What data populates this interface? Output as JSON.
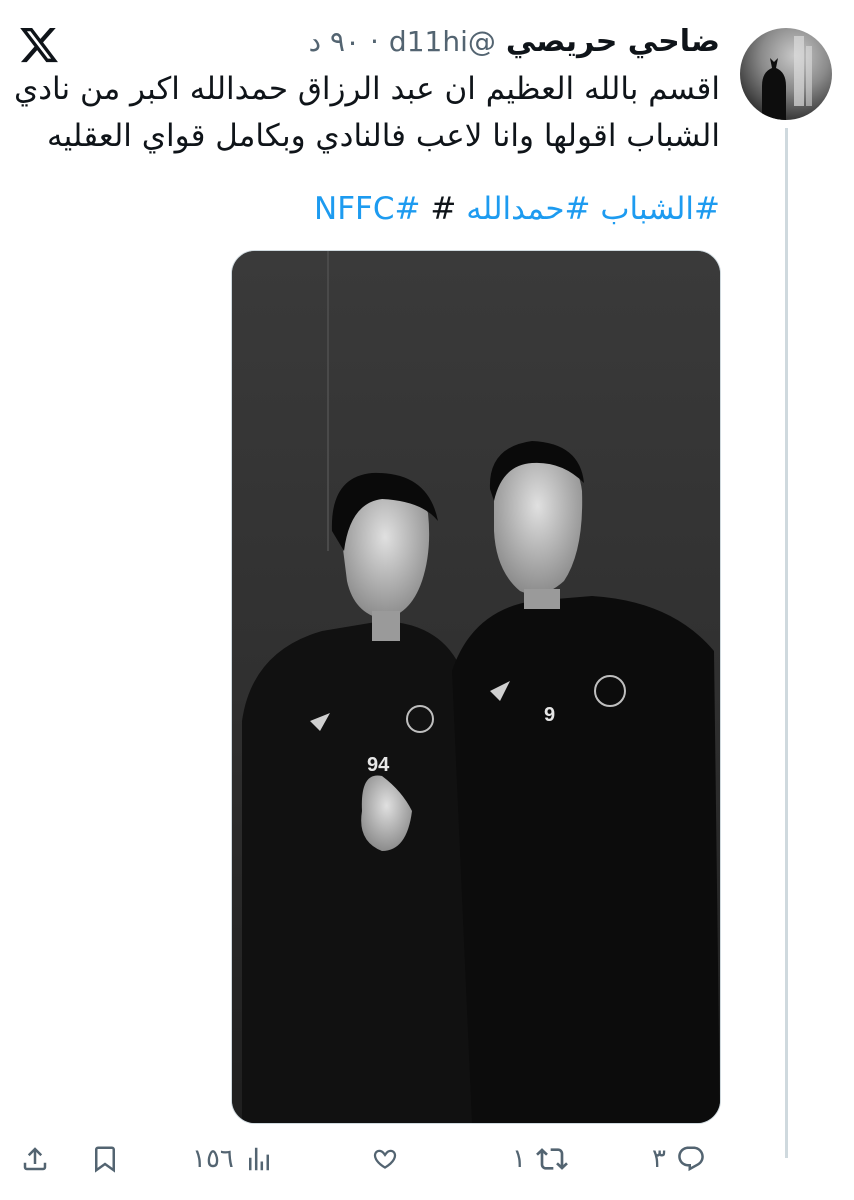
{
  "tweet": {
    "display_name": "ضاحي حريصي",
    "handle": "@d11hi",
    "dot": "·",
    "time": "٩٠ د",
    "text_lines": [
      "اقسم بالله العظيم ان عبد الرزاق حمدالله اكبر من نادي",
      "الشباب اقولها وانا لاعب فالنادي وبكامل قواي العقليه"
    ],
    "hashtags": [
      "#الشباب",
      "#حمدالله",
      "#",
      "#NFFC"
    ],
    "media": {
      "jersey_left": "94",
      "jersey_right": "9"
    },
    "actions": {
      "reply_count": "٣",
      "retweet_count": "١",
      "views_count": "١٥٦"
    }
  },
  "icons": {
    "logo": "x-logo-icon",
    "reply": "reply-icon",
    "retweet": "retweet-icon",
    "like": "like-icon",
    "views": "views-icon",
    "bookmark": "bookmark-icon",
    "share": "share-icon"
  },
  "colors": {
    "link": "#1d9bf0",
    "secondary": "#536471",
    "text": "#0f1419"
  }
}
